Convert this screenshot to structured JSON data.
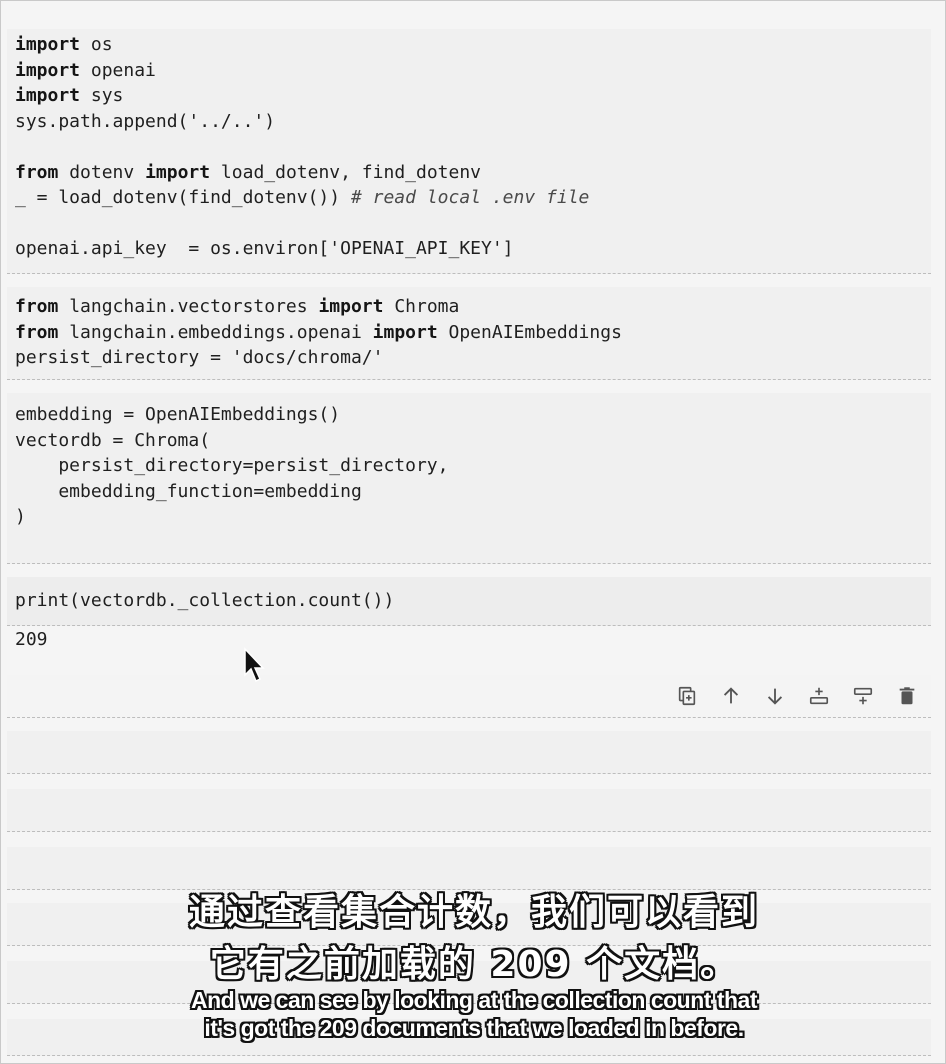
{
  "cells": {
    "c1": {
      "l1_kw": "import",
      "l1_rest": " os",
      "l2_kw": "import",
      "l2_rest": " openai",
      "l3_kw": "import",
      "l3_rest": " sys",
      "l4": "sys.path.append('../..')",
      "l6_kw1": "from",
      "l6_mid": " dotenv ",
      "l6_kw2": "import",
      "l6_rest": " load_dotenv, find_dotenv",
      "l7_code": "_ = load_dotenv(find_dotenv()) ",
      "l7_cmt": "# read local .env file",
      "l9": "openai.api_key  = os.environ['OPENAI_API_KEY']"
    },
    "c2": {
      "l1_kw1": "from",
      "l1_mid": " langchain.vectorstores ",
      "l1_kw2": "import",
      "l1_rest": " Chroma",
      "l2_kw1": "from",
      "l2_mid": " langchain.embeddings.openai ",
      "l2_kw2": "import",
      "l2_rest": " OpenAIEmbeddings",
      "l3": "persist_directory = 'docs/chroma/'"
    },
    "c3": {
      "l1": "embedding = OpenAIEmbeddings()",
      "l2": "vectordb = Chroma(",
      "l3": "    persist_directory=persist_directory,",
      "l4": "    embedding_function=embedding",
      "l5": ")"
    },
    "c4": {
      "l1": "print(vectordb._collection.count())",
      "output": "209"
    }
  },
  "toolbar": {
    "icons": [
      "duplicate-icon",
      "move-up-icon",
      "move-down-icon",
      "insert-above-icon",
      "insert-below-icon",
      "delete-icon"
    ]
  },
  "subtitles": {
    "zh_line1": "通过查看集合计数，我们可以看到",
    "zh_line2": "它有之前加载的 209 个文档。",
    "en_line1": "And we can see by looking at the collection count that",
    "en_line2": "it's got the 209 documents that we loaded in before."
  }
}
